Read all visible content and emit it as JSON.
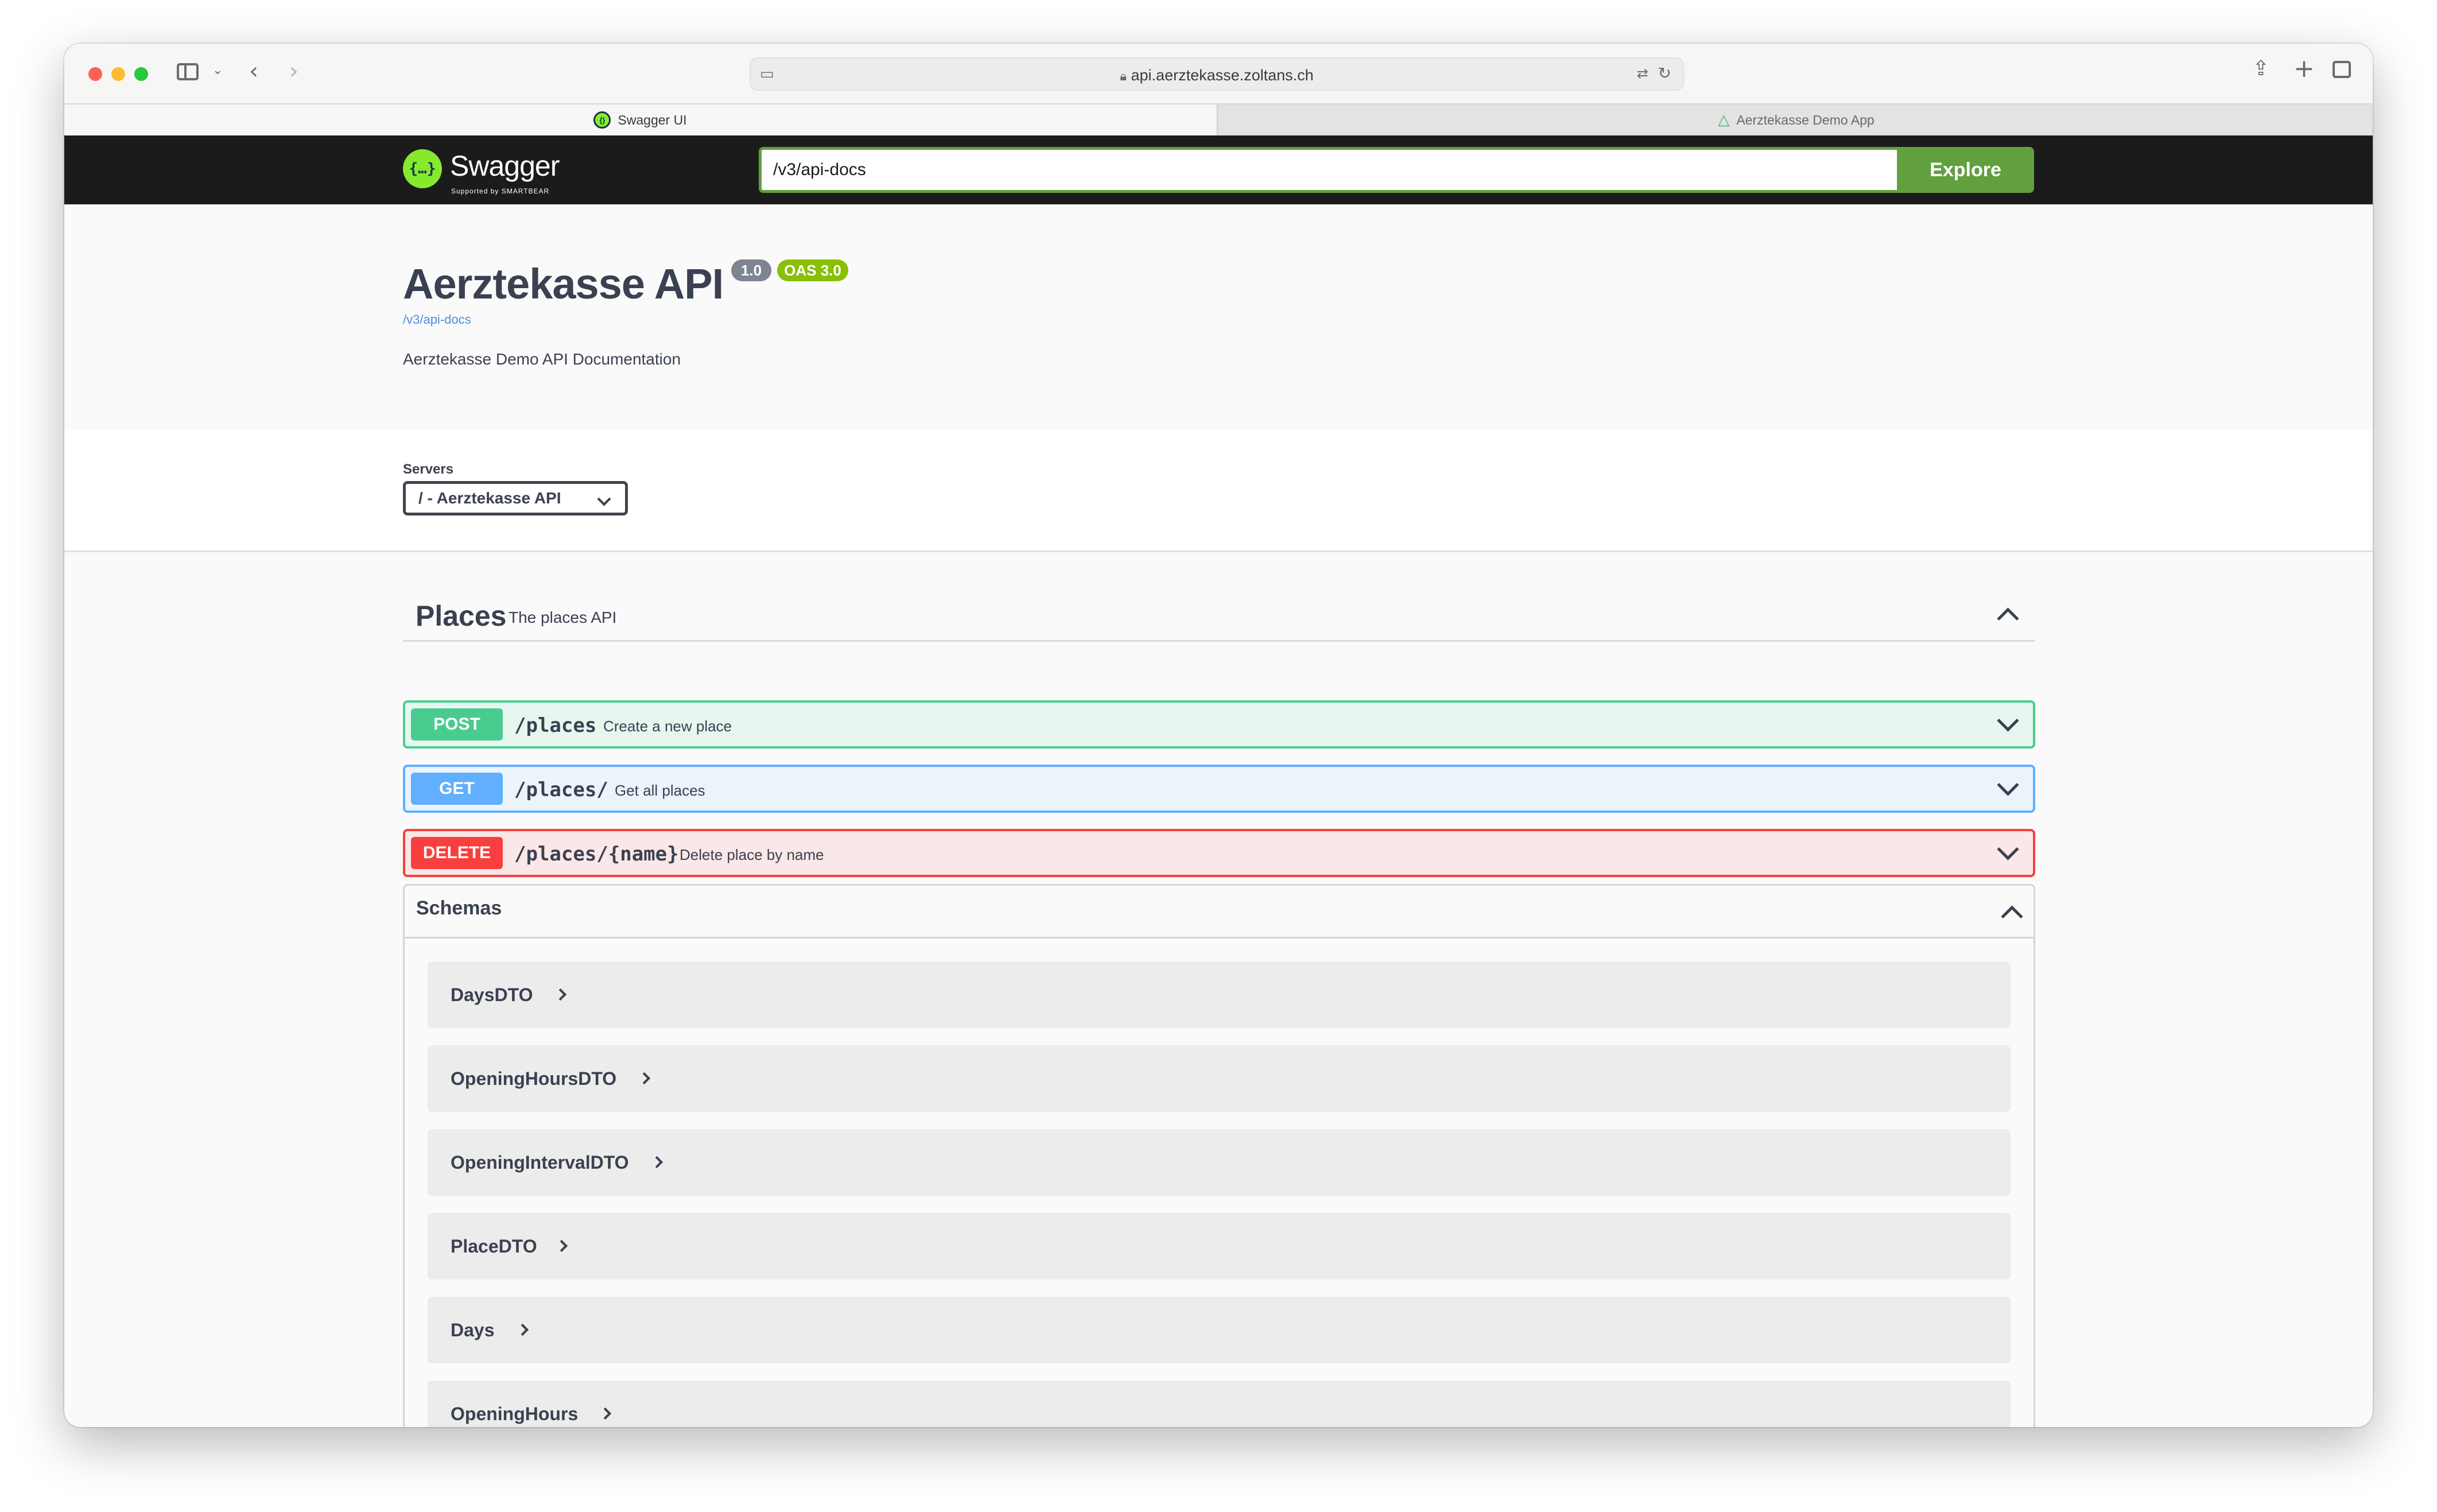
{
  "browser": {
    "url": "api.aerztekasse.zoltans.ch",
    "tabs": [
      {
        "label": "Swagger UI",
        "active": true
      },
      {
        "label": "Aerztekasse Demo App",
        "active": false
      }
    ]
  },
  "topbar": {
    "logo_text": "Swagger",
    "logo_subtext": "Supported by SMARTBEAR",
    "explore_value": "/v3/api-docs",
    "explore_label": "Explore",
    "accent_color": "#62a03f"
  },
  "info": {
    "title": "Aerztekasse API",
    "version": "1.0",
    "oas_badge": "OAS 3.0",
    "spec_link": "/v3/api-docs",
    "description": "Aerztekasse Demo API Documentation"
  },
  "servers": {
    "label": "Servers",
    "selected": "/ - Aerztekasse API"
  },
  "tag": {
    "name": "Places",
    "description": "The places API",
    "operations": [
      {
        "method": "POST",
        "path": "/places",
        "summary": "Create a new place",
        "color": "#49cc90"
      },
      {
        "method": "GET",
        "path": "/places/",
        "summary": "Get all places",
        "color": "#61affe"
      },
      {
        "method": "DELETE",
        "path": "/places/{name}",
        "summary": "Delete place by name",
        "color": "#f93e3e"
      }
    ]
  },
  "schemas": {
    "title": "Schemas",
    "models": [
      "DaysDTO",
      "OpeningHoursDTO",
      "OpeningIntervalDTO",
      "PlaceDTO",
      "Days",
      "OpeningHours"
    ]
  }
}
